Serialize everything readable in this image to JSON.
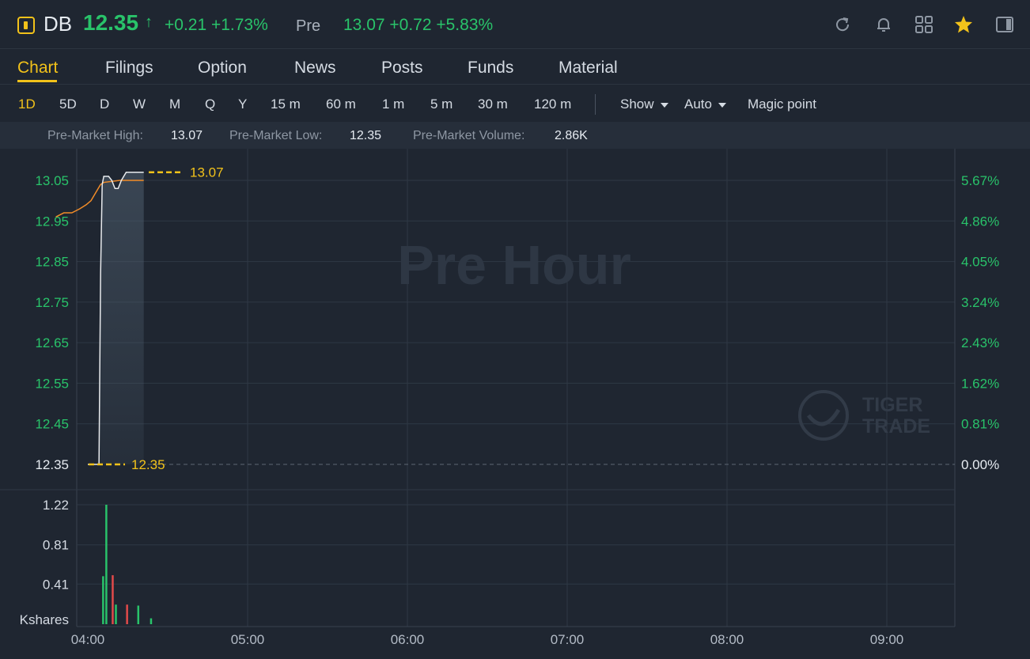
{
  "header": {
    "symbol": "DB",
    "price": "12.35",
    "price_arrow": "↑",
    "change": "+0.21 +1.73%",
    "pre_label": "Pre",
    "pre_value": "13.07 +0.72 +5.83%",
    "icons": [
      "refresh-icon",
      "bell-icon",
      "grid-icon",
      "star-icon",
      "sidebar-toggle-icon"
    ],
    "accent_color": "#f2c21a",
    "up_color": "#29c36a",
    "down_color": "#e24a4a"
  },
  "tabs": [
    {
      "label": "Chart",
      "active": true
    },
    {
      "label": "Filings"
    },
    {
      "label": "Option"
    },
    {
      "label": "News"
    },
    {
      "label": "Posts"
    },
    {
      "label": "Funds"
    },
    {
      "label": "Material"
    }
  ],
  "periods": [
    "1D",
    "5D",
    "D",
    "W",
    "M",
    "Q",
    "Y",
    "15 m",
    "60 m",
    "1 m",
    "5 m",
    "30 m",
    "120 m"
  ],
  "active_period": "1D",
  "controls": {
    "show": "Show",
    "auto": "Auto",
    "magic": "Magic point"
  },
  "stats": {
    "high_label": "Pre-Market High:",
    "high_value": "13.07",
    "low_label": "Pre-Market Low:",
    "low_value": "12.35",
    "volume_label": "Pre-Market Volume:",
    "volume_value": "2.86K"
  },
  "chart_data": {
    "type": "line",
    "watermark": "Pre Hour",
    "brand_watermark": [
      "TIGER",
      "TRADE"
    ],
    "x_ticks": [
      "04:00",
      "05:00",
      "06:00",
      "07:00",
      "08:00",
      "09:00"
    ],
    "y_ticks": [
      "13.05",
      "12.95",
      "12.85",
      "12.75",
      "12.65",
      "12.55",
      "12.45",
      "12.35"
    ],
    "y_pct_ticks": [
      "5.67%",
      "4.86%",
      "4.05%",
      "3.24%",
      "2.43%",
      "1.62%",
      "0.81%",
      "0.00%"
    ],
    "ylim": [
      12.35,
      13.07
    ],
    "reference_close": 12.35,
    "high_marker": "13.07",
    "low_marker": "12.35",
    "price_series": {
      "name": "Price",
      "color": "#e8eaed",
      "points": [
        [
          0.0,
          12.35
        ],
        [
          0.07,
          12.35
        ],
        [
          0.08,
          12.82
        ],
        [
          0.09,
          13.04
        ],
        [
          0.1,
          13.06
        ],
        [
          0.13,
          13.06
        ],
        [
          0.15,
          13.05
        ],
        [
          0.17,
          13.03
        ],
        [
          0.19,
          13.03
        ],
        [
          0.21,
          13.05
        ],
        [
          0.24,
          13.07
        ],
        [
          0.3,
          13.07
        ],
        [
          0.4,
          13.07
        ],
        [
          0.6,
          13.07
        ],
        [
          0.75,
          13.07
        ]
      ]
    },
    "avg_series": {
      "name": "Average",
      "color": "#f28c28",
      "points": [
        [
          -0.2,
          12.96
        ],
        [
          -0.15,
          12.97
        ],
        [
          -0.1,
          12.97
        ],
        [
          -0.05,
          12.98
        ],
        [
          -0.01,
          12.99
        ],
        [
          0.02,
          13.0
        ],
        [
          0.05,
          13.02
        ],
        [
          0.08,
          13.04
        ],
        [
          0.1,
          13.045
        ],
        [
          0.2,
          13.05
        ],
        [
          0.4,
          13.05
        ],
        [
          0.75,
          13.05
        ]
      ]
    },
    "volume": {
      "unit": "Kshares",
      "ticks": [
        "1.22",
        "0.81",
        "0.41"
      ],
      "bars": [
        {
          "t": 0.05,
          "v": 0.49,
          "dir": "up"
        },
        {
          "t": 0.07,
          "v": 1.22,
          "dir": "up"
        },
        {
          "t": 0.11,
          "v": 0.5,
          "dir": "down"
        },
        {
          "t": 0.13,
          "v": 0.2,
          "dir": "up"
        },
        {
          "t": 0.2,
          "v": 0.2,
          "dir": "down"
        },
        {
          "t": 0.27,
          "v": 0.19,
          "dir": "up"
        },
        {
          "t": 0.35,
          "v": 0.06,
          "dir": "up"
        }
      ]
    }
  }
}
